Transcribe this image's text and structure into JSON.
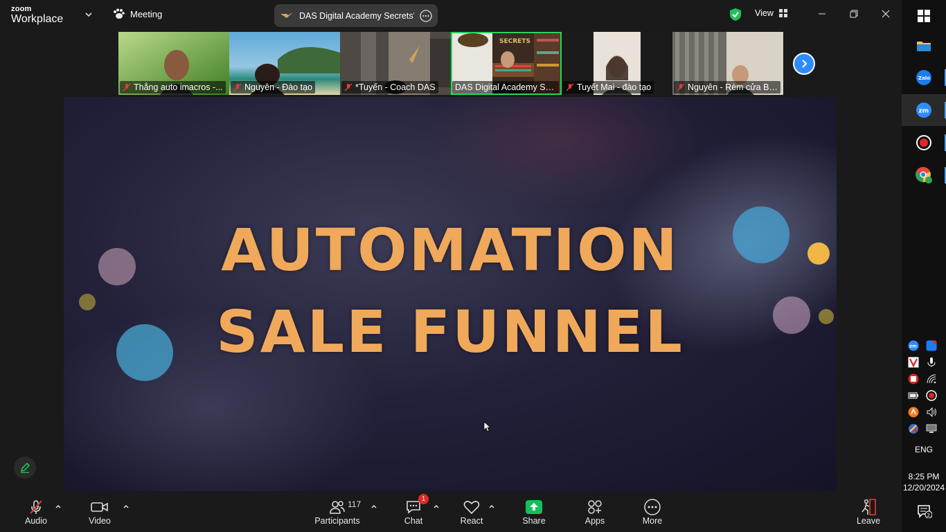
{
  "app": {
    "brand_top": "zoom",
    "brand_bottom": "Workplace"
  },
  "titlebar": {
    "meeting_label": "Meeting",
    "session_title": "DAS Digital Academy Secrets's sc",
    "view_label": "View"
  },
  "participants_strip": [
    {
      "name": "Thắng auto imacros -...",
      "muted": true,
      "active": false,
      "bg": "#6aa13a"
    },
    {
      "name": "Nguyên - Đào tạo",
      "muted": true,
      "active": false,
      "bg": "#3b89b8"
    },
    {
      "name": "*Tuyến - Coach DAS",
      "muted": true,
      "active": false,
      "bg": "#5c5550"
    },
    {
      "name": "DAS Digital Academy Se...",
      "muted": false,
      "active": true,
      "bg": "#4a2f22"
    },
    {
      "name": "Tuyết Mai - đào tạo",
      "muted": true,
      "active": false,
      "bg": "#1b1b1b"
    },
    {
      "name": "Nguyên - Rèm cửa Bli...",
      "muted": true,
      "active": false,
      "bg": "#6e6a64"
    }
  ],
  "slide": {
    "line1": "AUTOMATION",
    "line2": "SALE FUNNEL"
  },
  "toolbar": {
    "audio": "Audio",
    "video": "Video",
    "participants": "Participants",
    "participants_count": "117",
    "chat": "Chat",
    "chat_badge": "1",
    "react": "React",
    "share": "Share",
    "apps": "Apps",
    "more": "More",
    "leave": "Leave"
  },
  "taskbar": {
    "lang": "ENG",
    "time": "8:25 PM",
    "date": "12/20/2024",
    "notification_count": "2"
  },
  "colors": {
    "accent": "#2d8cff",
    "share_green": "#12c05a",
    "active_border": "#23d959",
    "slide_text": "#f0a95a"
  }
}
